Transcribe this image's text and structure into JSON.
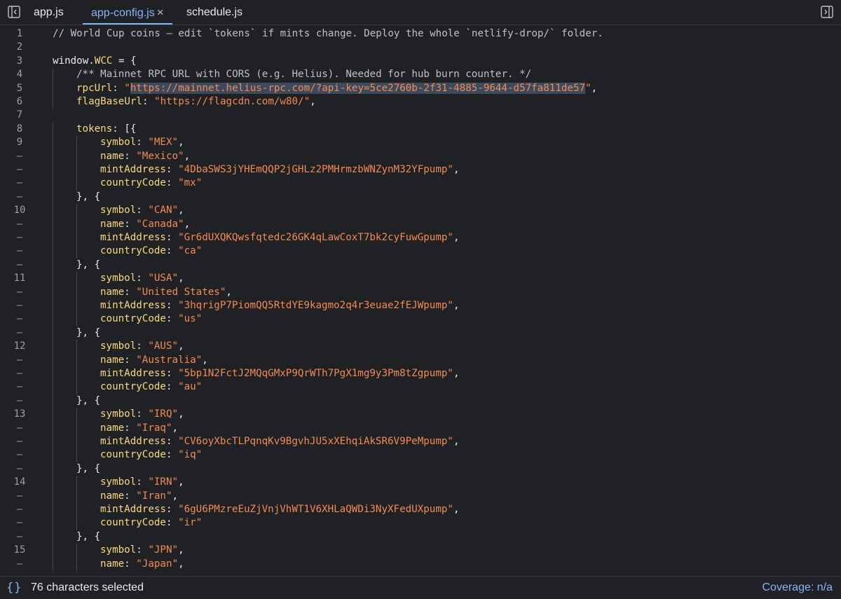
{
  "tabs": [
    {
      "label": "app.js",
      "active": false
    },
    {
      "label": "app-config.js",
      "active": true,
      "close": "×"
    },
    {
      "label": "schedule.js",
      "active": false
    }
  ],
  "icons": {
    "left_toggle": "sidebar-left-toggle-icon",
    "right_toggle": "sidebar-right-toggle-icon",
    "status": "curly-braces-icon"
  },
  "colors": {
    "background": "#202124",
    "accent": "#8ab4f8",
    "string": "#f28b54",
    "property": "#f9d97f"
  },
  "editor": {
    "lines": [
      {
        "g": "1",
        "i": 0,
        "t": [
          [
            "c",
            "// World Cup coins — edit `tokens` if mints change. Deploy the whole `netlify-drop/` folder."
          ]
        ]
      },
      {
        "g": "2",
        "i": 0,
        "t": []
      },
      {
        "g": "3",
        "i": 0,
        "t": [
          [
            "p",
            "window."
          ],
          [
            "v",
            "WCC"
          ],
          [
            "p",
            " = {"
          ]
        ]
      },
      {
        "g": "4",
        "i": 1,
        "t": [
          [
            "c",
            "/** Mainnet RPC URL with CORS (e.g. Helius). Needed for hub burn counter. */"
          ]
        ]
      },
      {
        "g": "5",
        "i": 1,
        "t": [
          [
            "k",
            "rpcUrl"
          ],
          [
            "p",
            ": "
          ],
          [
            "s",
            "\""
          ],
          [
            "ss",
            "https://mainnet.helius-rpc.com/?api-key=5ce2760b-2f31-4885-9644-d57fa811de57"
          ],
          [
            "s",
            "\""
          ],
          [
            "p",
            ","
          ]
        ]
      },
      {
        "g": "6",
        "i": 1,
        "t": [
          [
            "k",
            "flagBaseUrl"
          ],
          [
            "p",
            ": "
          ],
          [
            "s",
            "\"https://flagcdn.com/w80/\""
          ],
          [
            "p",
            ","
          ]
        ]
      },
      {
        "g": "7",
        "i": 0,
        "t": []
      },
      {
        "g": "8",
        "i": 1,
        "t": [
          [
            "k",
            "tokens"
          ],
          [
            "p",
            ": [{"
          ]
        ]
      },
      {
        "g": "9",
        "i": 2,
        "t": [
          [
            "k",
            "symbol"
          ],
          [
            "p",
            ": "
          ],
          [
            "s",
            "\"MEX\""
          ],
          [
            "p",
            ","
          ]
        ]
      },
      {
        "g": "–",
        "i": 2,
        "t": [
          [
            "k",
            "name"
          ],
          [
            "p",
            ": "
          ],
          [
            "s",
            "\"Mexico\""
          ],
          [
            "p",
            ","
          ]
        ]
      },
      {
        "g": "–",
        "i": 2,
        "t": [
          [
            "k",
            "mintAddress"
          ],
          [
            "p",
            ": "
          ],
          [
            "s",
            "\"4DbaSWS3jYHEmQQP2jGHLz2PMHrmzbWNZynM32YFpump\""
          ],
          [
            "p",
            ","
          ]
        ]
      },
      {
        "g": "–",
        "i": 2,
        "t": [
          [
            "k",
            "countryCode"
          ],
          [
            "p",
            ": "
          ],
          [
            "s",
            "\"mx\""
          ]
        ]
      },
      {
        "g": "–",
        "i": 1,
        "t": [
          [
            "p",
            "}, {"
          ]
        ]
      },
      {
        "g": "10",
        "i": 2,
        "t": [
          [
            "k",
            "symbol"
          ],
          [
            "p",
            ": "
          ],
          [
            "s",
            "\"CAN\""
          ],
          [
            "p",
            ","
          ]
        ]
      },
      {
        "g": "–",
        "i": 2,
        "t": [
          [
            "k",
            "name"
          ],
          [
            "p",
            ": "
          ],
          [
            "s",
            "\"Canada\""
          ],
          [
            "p",
            ","
          ]
        ]
      },
      {
        "g": "–",
        "i": 2,
        "t": [
          [
            "k",
            "mintAddress"
          ],
          [
            "p",
            ": "
          ],
          [
            "s",
            "\"Gr6dUXQKQwsfqtedc26GK4qLawCoxT7bk2cyFuwGpump\""
          ],
          [
            "p",
            ","
          ]
        ]
      },
      {
        "g": "–",
        "i": 2,
        "t": [
          [
            "k",
            "countryCode"
          ],
          [
            "p",
            ": "
          ],
          [
            "s",
            "\"ca\""
          ]
        ]
      },
      {
        "g": "–",
        "i": 1,
        "t": [
          [
            "p",
            "}, {"
          ]
        ]
      },
      {
        "g": "11",
        "i": 2,
        "t": [
          [
            "k",
            "symbol"
          ],
          [
            "p",
            ": "
          ],
          [
            "s",
            "\"USA\""
          ],
          [
            "p",
            ","
          ]
        ]
      },
      {
        "g": "–",
        "i": 2,
        "t": [
          [
            "k",
            "name"
          ],
          [
            "p",
            ": "
          ],
          [
            "s",
            "\"United States\""
          ],
          [
            "p",
            ","
          ]
        ]
      },
      {
        "g": "–",
        "i": 2,
        "t": [
          [
            "k",
            "mintAddress"
          ],
          [
            "p",
            ": "
          ],
          [
            "s",
            "\"3hqrigP7PiomQQ5RtdYE9kagmo2q4r3euae2fEJWpump\""
          ],
          [
            "p",
            ","
          ]
        ]
      },
      {
        "g": "–",
        "i": 2,
        "t": [
          [
            "k",
            "countryCode"
          ],
          [
            "p",
            ": "
          ],
          [
            "s",
            "\"us\""
          ]
        ]
      },
      {
        "g": "–",
        "i": 1,
        "t": [
          [
            "p",
            "}, {"
          ]
        ]
      },
      {
        "g": "12",
        "i": 2,
        "t": [
          [
            "k",
            "symbol"
          ],
          [
            "p",
            ": "
          ],
          [
            "s",
            "\"AUS\""
          ],
          [
            "p",
            ","
          ]
        ]
      },
      {
        "g": "–",
        "i": 2,
        "t": [
          [
            "k",
            "name"
          ],
          [
            "p",
            ": "
          ],
          [
            "s",
            "\"Australia\""
          ],
          [
            "p",
            ","
          ]
        ]
      },
      {
        "g": "–",
        "i": 2,
        "t": [
          [
            "k",
            "mintAddress"
          ],
          [
            "p",
            ": "
          ],
          [
            "s",
            "\"5bp1N2FctJ2MQqGMxP9QrWTh7PgX1mg9y3Pm8tZgpump\""
          ],
          [
            "p",
            ","
          ]
        ]
      },
      {
        "g": "–",
        "i": 2,
        "t": [
          [
            "k",
            "countryCode"
          ],
          [
            "p",
            ": "
          ],
          [
            "s",
            "\"au\""
          ]
        ]
      },
      {
        "g": "–",
        "i": 1,
        "t": [
          [
            "p",
            "}, {"
          ]
        ]
      },
      {
        "g": "13",
        "i": 2,
        "t": [
          [
            "k",
            "symbol"
          ],
          [
            "p",
            ": "
          ],
          [
            "s",
            "\"IRQ\""
          ],
          [
            "p",
            ","
          ]
        ]
      },
      {
        "g": "–",
        "i": 2,
        "t": [
          [
            "k",
            "name"
          ],
          [
            "p",
            ": "
          ],
          [
            "s",
            "\"Iraq\""
          ],
          [
            "p",
            ","
          ]
        ]
      },
      {
        "g": "–",
        "i": 2,
        "t": [
          [
            "k",
            "mintAddress"
          ],
          [
            "p",
            ": "
          ],
          [
            "s",
            "\"CV6oyXbcTLPqnqKv9BgvhJU5xXEhqiAkSR6V9PeMpump\""
          ],
          [
            "p",
            ","
          ]
        ]
      },
      {
        "g": "–",
        "i": 2,
        "t": [
          [
            "k",
            "countryCode"
          ],
          [
            "p",
            ": "
          ],
          [
            "s",
            "\"iq\""
          ]
        ]
      },
      {
        "g": "–",
        "i": 1,
        "t": [
          [
            "p",
            "}, {"
          ]
        ]
      },
      {
        "g": "14",
        "i": 2,
        "t": [
          [
            "k",
            "symbol"
          ],
          [
            "p",
            ": "
          ],
          [
            "s",
            "\"IRN\""
          ],
          [
            "p",
            ","
          ]
        ]
      },
      {
        "g": "–",
        "i": 2,
        "t": [
          [
            "k",
            "name"
          ],
          [
            "p",
            ": "
          ],
          [
            "s",
            "\"Iran\""
          ],
          [
            "p",
            ","
          ]
        ]
      },
      {
        "g": "–",
        "i": 2,
        "t": [
          [
            "k",
            "mintAddress"
          ],
          [
            "p",
            ": "
          ],
          [
            "s",
            "\"6gU6PMzreEuZjVnjVhWT1V6XHLaQWDi3NyXFedUXpump\""
          ],
          [
            "p",
            ","
          ]
        ]
      },
      {
        "g": "–",
        "i": 2,
        "t": [
          [
            "k",
            "countryCode"
          ],
          [
            "p",
            ": "
          ],
          [
            "s",
            "\"ir\""
          ]
        ]
      },
      {
        "g": "–",
        "i": 1,
        "t": [
          [
            "p",
            "}, {"
          ]
        ]
      },
      {
        "g": "15",
        "i": 2,
        "t": [
          [
            "k",
            "symbol"
          ],
          [
            "p",
            ": "
          ],
          [
            "s",
            "\"JPN\""
          ],
          [
            "p",
            ","
          ]
        ]
      },
      {
        "g": "–",
        "i": 2,
        "t": [
          [
            "k",
            "name"
          ],
          [
            "p",
            ": "
          ],
          [
            "s",
            "\"Japan\""
          ],
          [
            "p",
            ","
          ]
        ]
      }
    ]
  },
  "status": {
    "selection": "76 characters selected",
    "coverage": "Coverage: n/a",
    "braces": "{}"
  }
}
